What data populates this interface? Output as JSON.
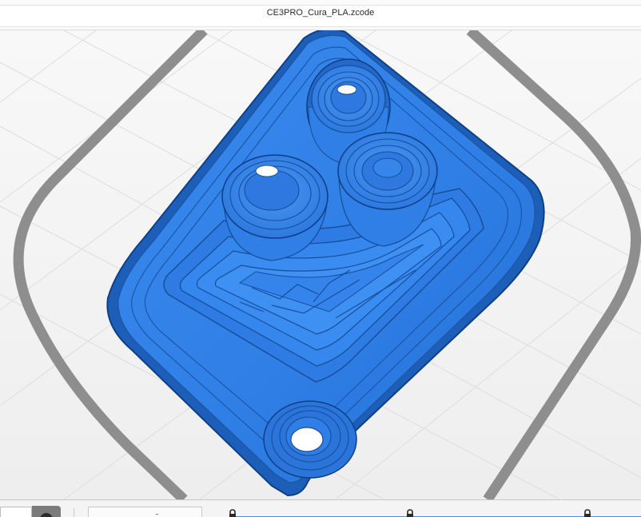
{
  "window": {
    "title": "CE3PRO_Cura_PLA.zcode"
  },
  "viewport": {
    "colors": {
      "model": "#2f7fe6",
      "model_highlight": "#4694f2",
      "model_shadow": "#1d5fb8",
      "model_outline": "#0e3f86",
      "bed_border": "#8e8e8e",
      "grid_line": "#dcdcdc",
      "background": "#f3f3f3"
    },
    "icons": [
      "lock-icon"
    ]
  },
  "bottom_bar": {
    "layer_slider": {
      "handles": [
        "lock-icon",
        "lock-icon",
        "lock-icon"
      ]
    }
  }
}
